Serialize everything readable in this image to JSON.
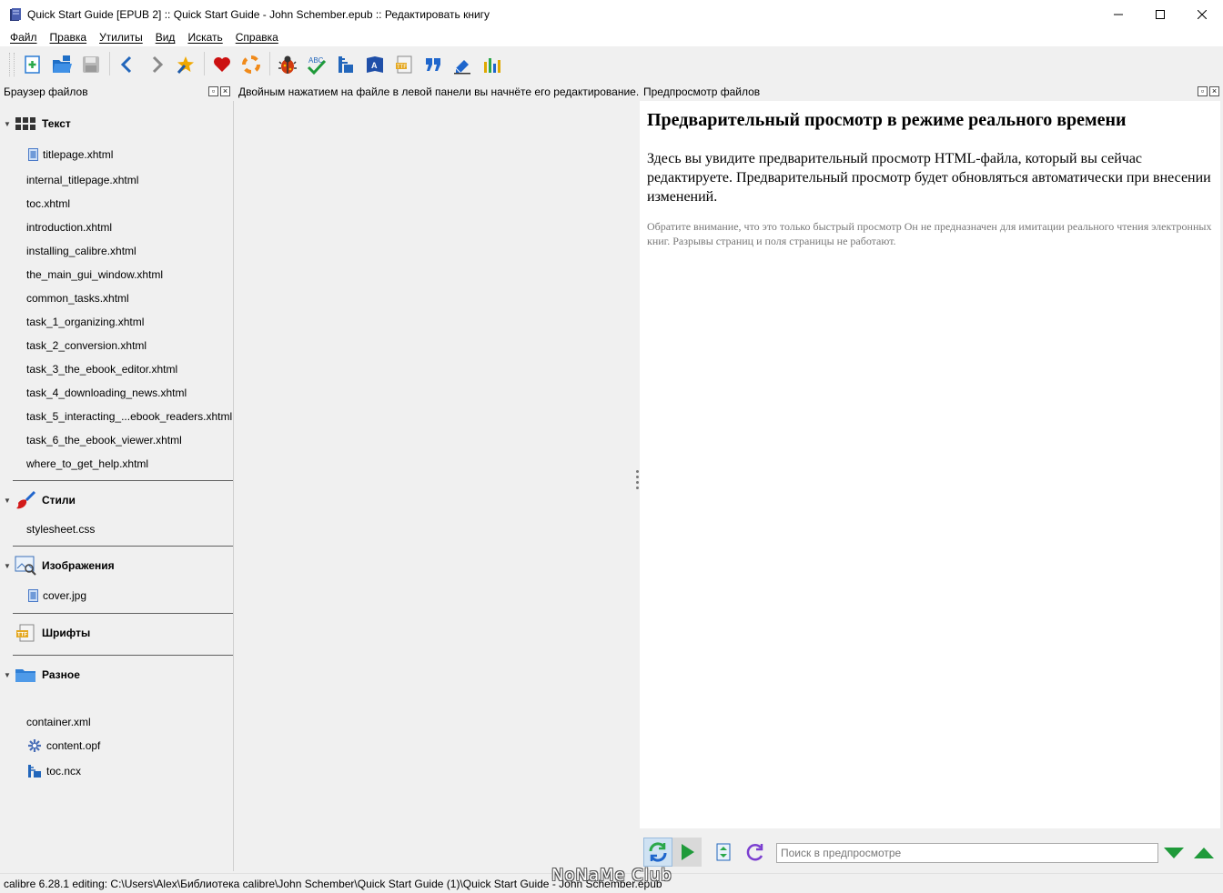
{
  "window": {
    "title": "Quick Start Guide [EPUB 2] :: Quick Start Guide - John Schember.epub :: Редактировать книгу",
    "minimize": "—",
    "maximize": "☐",
    "close": "✕"
  },
  "menu": [
    "Файл",
    "Правка",
    "Утилиты",
    "Вид",
    "Искать",
    "Справка"
  ],
  "toolbar": {
    "icons": [
      "new-file-icon",
      "open-book-icon",
      "save-icon",
      "undo-icon",
      "redo-icon",
      "checkpoint-icon",
      "donate-heart-icon",
      "help-ring-icon",
      "check-book-icon",
      "spellcheck-icon",
      "toc-icon",
      "reports-icon",
      "embed-fonts-icon",
      "smart-quotes-icon",
      "remove-unused-css-icon",
      "stats-icon"
    ]
  },
  "left_panel": {
    "title": "Браузер файлов",
    "categories": {
      "text": {
        "label": "Текст",
        "files": [
          "titlepage.xhtml",
          "internal_titlepage.xhtml",
          "toc.xhtml",
          "introduction.xhtml",
          "installing_calibre.xhtml",
          "the_main_gui_window.xhtml",
          "common_tasks.xhtml",
          "task_1_organizing.xhtml",
          "task_2_conversion.xhtml",
          "task_3_the_ebook_editor.xhtml",
          "task_4_downloading_news.xhtml",
          "task_5_interacting_...ebook_readers.xhtml",
          "task_6_the_ebook_viewer.xhtml",
          "where_to_get_help.xhtml"
        ]
      },
      "styles": {
        "label": "Стили",
        "files": [
          "stylesheet.css"
        ]
      },
      "images": {
        "label": "Изображения",
        "files": [
          "cover.jpg"
        ]
      },
      "fonts": {
        "label": "Шрифты"
      },
      "misc": {
        "label": "Разное",
        "files": [
          "container.xml",
          "content.opf",
          "toc.ncx"
        ]
      }
    }
  },
  "middle": {
    "hint": "Двойным нажатием на файле в левой панели вы начнёте его редактирование."
  },
  "right_panel": {
    "title": "Предпросмотр файлов",
    "heading": "Предварительный просмотр в режиме реального времени",
    "paragraph": "Здесь вы увидите предварительный просмотр HTML-файла, который вы сейчас редактируете. Предварительный просмотр будет обновляться автоматически при внесении изменений.",
    "note": "Обратите внимание, что это только быстрый просмотр Он не предназначен для имитации реального чтения электронных книг. Разрывы страниц и поля страницы не работают.",
    "search_placeholder": "Поиск в предпросмотре"
  },
  "statusbar": {
    "text": "calibre 6.28.1 editing: C:\\Users\\Alex\\Библиотека calibre\\John Schember\\Quick Start Guide (1)\\Quick Start Guide - John Schember.epub"
  },
  "watermark": "NoNaMe Club"
}
